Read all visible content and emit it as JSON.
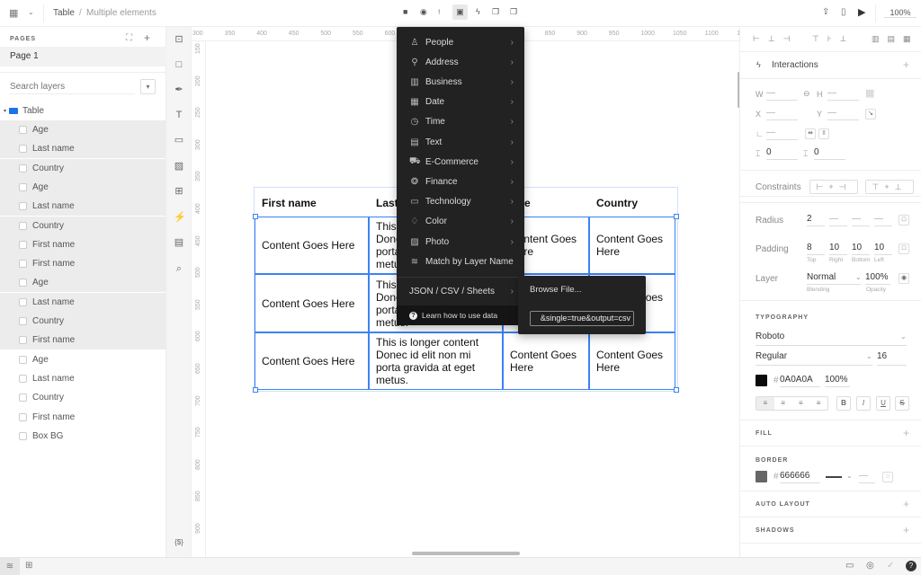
{
  "topbar": {
    "breadcrumb_root": "Table",
    "breadcrumb_sep": "/",
    "breadcrumb_current": "Multiple elements",
    "zoom": "100%"
  },
  "pages": {
    "heading": "PAGES",
    "items": [
      "Page 1"
    ]
  },
  "layers": {
    "search_placeholder": "Search layers",
    "group": "Table",
    "items": [
      {
        "label": "Age",
        "selected": true
      },
      {
        "label": "Last name",
        "selected": true
      },
      {
        "label": "Country",
        "selected": true
      },
      {
        "label": "Age",
        "selected": true
      },
      {
        "label": "Last name",
        "selected": true
      },
      {
        "label": "Country",
        "selected": true
      },
      {
        "label": "First name",
        "selected": true
      },
      {
        "label": "First name",
        "selected": true
      },
      {
        "label": "Age",
        "selected": true
      },
      {
        "label": "Last name",
        "selected": true
      },
      {
        "label": "Country",
        "selected": true
      },
      {
        "label": "First name",
        "selected": true
      },
      {
        "label": "Age",
        "selected": false
      },
      {
        "label": "Last name",
        "selected": false
      },
      {
        "label": "Country",
        "selected": false
      },
      {
        "label": "First name",
        "selected": false
      },
      {
        "label": "Box BG",
        "selected": false
      }
    ]
  },
  "tools": {
    "data_label": "{$}"
  },
  "ruler": {
    "top": [
      "300",
      "350",
      "400",
      "450",
      "500",
      "550",
      "600",
      "650",
      "700",
      "750",
      "800",
      "850",
      "900",
      "950",
      "1000",
      "1050",
      "1100",
      "1150"
    ],
    "left": [
      "150",
      "200",
      "250",
      "300",
      "350",
      "400",
      "450",
      "500",
      "550",
      "600",
      "650",
      "700",
      "750",
      "800",
      "850",
      "900"
    ]
  },
  "table": {
    "headers": [
      "First name",
      "Last name",
      "Age",
      "Country"
    ],
    "rows": [
      [
        "Content Goes Here",
        "This is longer content Donec id elit non mi porta gravida at eget metus.",
        "Content Goes Here",
        "Content Goes Here"
      ],
      [
        "Content Goes Here",
        "This is longer content Donec id elit non mi porta gravida at eget metus.",
        "Content Goes Here",
        "Content Goes Here"
      ],
      [
        "Content Goes Here",
        "This is longer content Donec id elit non mi porta gravida at eget metus.",
        "Content Goes Here",
        "Content Goes Here"
      ]
    ]
  },
  "data_menu": {
    "items": [
      {
        "label": "People",
        "icon": "person-icon"
      },
      {
        "label": "Address",
        "icon": "pin-icon"
      },
      {
        "label": "Business",
        "icon": "building-icon"
      },
      {
        "label": "Date",
        "icon": "calendar-icon"
      },
      {
        "label": "Time",
        "icon": "clock-icon"
      },
      {
        "label": "Text",
        "icon": "text-icon"
      },
      {
        "label": "E-Commerce",
        "icon": "cart-icon"
      },
      {
        "label": "Finance",
        "icon": "piggy-bank-icon"
      },
      {
        "label": "Technology",
        "icon": "laptop-icon"
      },
      {
        "label": "Color",
        "icon": "drop-icon"
      },
      {
        "label": "Photo",
        "icon": "image-icon"
      }
    ],
    "match": "Match by Layer Name",
    "json": "JSON / CSV / Sheets",
    "learn": "Learn how to use data"
  },
  "submenu": {
    "browse": "Browse File...",
    "url_value": "&single=true&output=csv"
  },
  "inspector": {
    "interactions": "Interactions",
    "w": "W",
    "h": "H",
    "x": "X",
    "y": "Y",
    "dash": "—",
    "spacing_a": "0",
    "spacing_b": "0",
    "constraints": "Constraints",
    "radius_label": "Radius",
    "radius": [
      "2",
      "—",
      "—",
      "—"
    ],
    "padding_label": "Padding",
    "padding": [
      "8",
      "10",
      "10",
      "10"
    ],
    "padding_sub": [
      "Top",
      "Right",
      "Bottom",
      "Left"
    ],
    "layer_label": "Layer",
    "blending": "Normal",
    "opacity": "100%",
    "blending_sub": "Blending",
    "opacity_sub": "Opacity",
    "typography": "TYPOGRAPHY",
    "font": "Roboto",
    "weight": "Regular",
    "size": "16",
    "text_color": "#0A0A0A",
    "text_color_display": "0A0A0A",
    "text_opacity": "100%",
    "fill": "FILL",
    "border": "BORDER",
    "border_color": "#666666",
    "border_color_display": "666666",
    "auto_layout": "AUTO LAYOUT",
    "shadows": "SHADOWS"
  },
  "colors": {
    "selection": "#3b82f6",
    "menu_bg": "#222222"
  }
}
